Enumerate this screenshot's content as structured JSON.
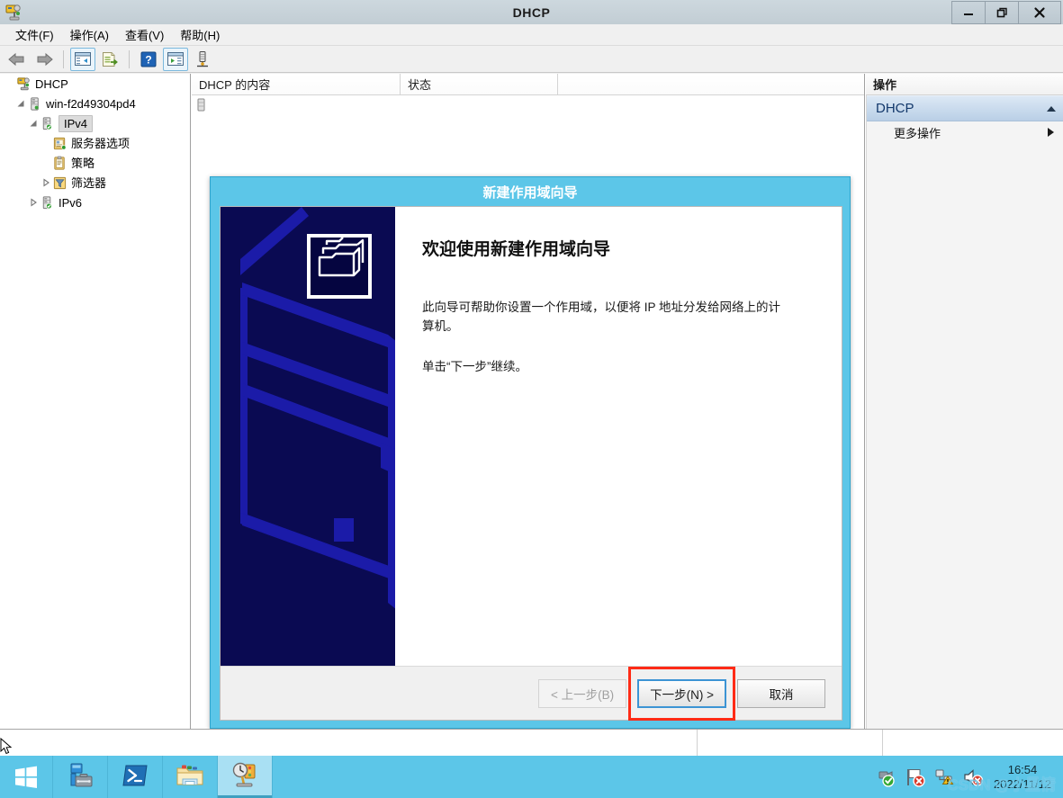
{
  "window": {
    "title": "DHCP",
    "icon": "dhcp-icon",
    "minimize_label": "–",
    "maximize_label": "❐",
    "close_label": "✕"
  },
  "menubar": {
    "items": [
      {
        "label": "文件(F)",
        "name": "menu-file"
      },
      {
        "label": "操作(A)",
        "name": "menu-action"
      },
      {
        "label": "查看(V)",
        "name": "menu-view"
      },
      {
        "label": "帮助(H)",
        "name": "menu-help"
      }
    ]
  },
  "toolbar": {
    "buttons": [
      {
        "name": "back-arrow-icon",
        "title": "后退"
      },
      {
        "name": "forward-arrow-icon",
        "title": "前进"
      },
      {
        "name": "show-tree-icon",
        "title": "显示/隐藏控制台树"
      },
      {
        "name": "export-list-icon",
        "title": "导出列表"
      },
      {
        "name": "help-icon",
        "title": "帮助"
      },
      {
        "name": "show-action-pane-icon",
        "title": "显示/隐藏操作窗格"
      },
      {
        "name": "refresh-server-icon",
        "title": "服务器"
      }
    ]
  },
  "tree": {
    "nodes": [
      {
        "label": "DHCP",
        "icon": "dhcp-root-icon",
        "indent": 0,
        "arrow": "none",
        "selected": false
      },
      {
        "label": "win-f2d49304pd4",
        "icon": "server-icon",
        "indent": 1,
        "arrow": "expanded",
        "selected": false
      },
      {
        "label": "IPv4",
        "icon": "ipv4-ok-icon",
        "indent": 2,
        "arrow": "expanded",
        "selected": true
      },
      {
        "label": "服务器选项",
        "icon": "server-options-icon",
        "indent": 3,
        "arrow": "none",
        "selected": false
      },
      {
        "label": "策略",
        "icon": "policy-icon",
        "indent": 3,
        "arrow": "none",
        "selected": false
      },
      {
        "label": "筛选器",
        "icon": "filter-icon",
        "indent": 3,
        "arrow": "collapsed",
        "selected": false
      },
      {
        "label": "IPv6",
        "icon": "ipv6-ok-icon",
        "indent": 2,
        "arrow": "collapsed",
        "selected": false
      }
    ]
  },
  "list": {
    "columns": [
      {
        "label": "DHCP 的内容"
      },
      {
        "label": "状态"
      },
      {
        "label": ""
      }
    ],
    "rows": []
  },
  "actions": {
    "title": "操作",
    "group": "DHCP",
    "group_collapse_icon": "caret-up-icon",
    "items": [
      {
        "label": "更多操作",
        "submenu_icon": "caret-right-icon"
      }
    ]
  },
  "dialog": {
    "title": "新建作用域向导",
    "heading": "欢迎使用新建作用域向导",
    "paragraph1": "此向导可帮助你设置一个作用域，以便将 IP 地址分发给网络上的计算机。",
    "paragraph2": "单击“下一步”继续。",
    "banner_icon": "folders-banner-icon",
    "buttons": {
      "back": {
        "label": "< 上一步(B)",
        "disabled": true,
        "highlighted": false
      },
      "next": {
        "label": "下一步(N) >",
        "disabled": false,
        "highlighted": true
      },
      "cancel": {
        "label": "取消",
        "disabled": false,
        "highlighted": false
      }
    }
  },
  "statusbar": {
    "text": "",
    "pane2": "",
    "pane3": ""
  },
  "taskbar": {
    "start_icon": "windows-start-icon",
    "items": [
      {
        "name": "taskbar-server-manager",
        "icon": "server-manager-icon",
        "active": false
      },
      {
        "name": "taskbar-powershell",
        "icon": "powershell-icon",
        "active": false
      },
      {
        "name": "taskbar-file-explorer",
        "icon": "file-explorer-icon",
        "active": false
      },
      {
        "name": "taskbar-dhcp",
        "icon": "dhcp-taskbar-icon",
        "active": true
      }
    ],
    "tray": [
      {
        "name": "network-ok-icon"
      },
      {
        "name": "flag-alert-icon"
      },
      {
        "name": "network-warning-icon"
      },
      {
        "name": "volume-muted-icon"
      }
    ],
    "clock": {
      "time": "16:54",
      "date": "2022/11/12"
    },
    "watermark": "CSDN @小星情"
  },
  "colors": {
    "accent_cyan": "#5cc6e8",
    "banner_navy": "#0a0a52",
    "banner_blue": "#1a1aa8",
    "highlight_red": "#ff2b16",
    "titlebar": "#c6d1d8",
    "action_group": "#b9cfe6"
  }
}
